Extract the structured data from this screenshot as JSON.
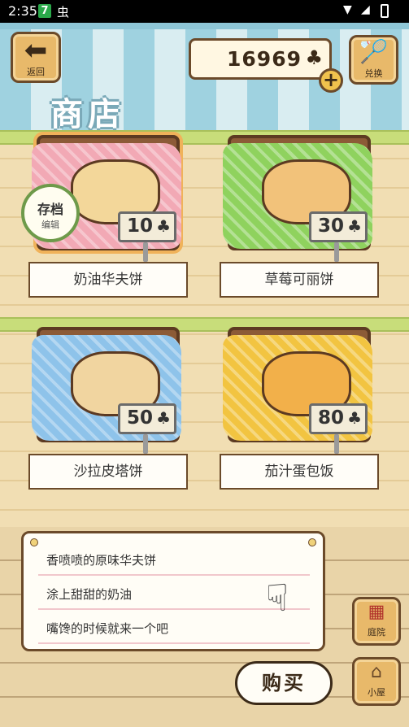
{
  "status_bar": {
    "time": "2:35",
    "badge": "7",
    "bug_icon": "虫"
  },
  "header": {
    "back_label": "返回",
    "exchange_label": "兑换",
    "currency_amount": "16969",
    "currency_icon": "♣",
    "title": "商店"
  },
  "save_badge": {
    "title": "存档",
    "subtitle": "编辑"
  },
  "items": [
    {
      "name": "奶油华夫饼",
      "price": "10",
      "price_icon": "♣",
      "cloth": "#f2a9b5",
      "food": "#f3d79a"
    },
    {
      "name": "草莓可丽饼",
      "price": "30",
      "price_icon": "♣",
      "cloth": "#8fd25e",
      "food": "#f2c27a"
    },
    {
      "name": "沙拉皮塔饼",
      "price": "50",
      "price_icon": "♣",
      "cloth": "#8ec3ea",
      "food": "#f1d5a0"
    },
    {
      "name": "茄汁蛋包饭",
      "price": "80",
      "price_icon": "♣",
      "cloth": "#f2c441",
      "food": "#f2b04a"
    }
  ],
  "description": {
    "lines": [
      "香喷喷的原味华夫饼",
      "涂上甜甜的奶油",
      "嘴馋的时候就来一个吧"
    ]
  },
  "buy_label": "购买",
  "side_buttons": {
    "yard_label": "庭院",
    "house_label": "小屋"
  }
}
